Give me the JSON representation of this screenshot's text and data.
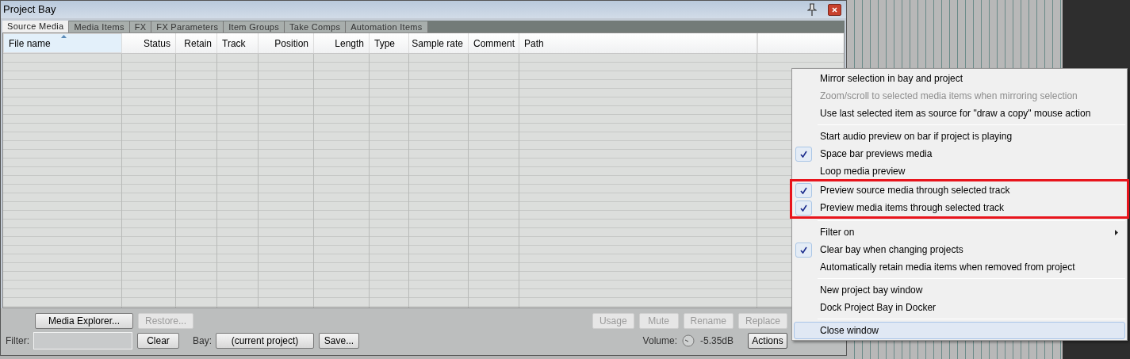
{
  "window": {
    "title": "Project Bay"
  },
  "tabs": [
    {
      "label": "Source Media",
      "selected": true
    },
    {
      "label": "Media Items",
      "selected": false
    },
    {
      "label": "FX",
      "selected": false
    },
    {
      "label": "FX Parameters",
      "selected": false
    },
    {
      "label": "Item Groups",
      "selected": false
    },
    {
      "label": "Take Comps",
      "selected": false
    },
    {
      "label": "Automation Items",
      "selected": false
    }
  ],
  "table": {
    "columns": [
      {
        "label": "File name",
        "sorted": true
      },
      {
        "label": "Status",
        "sorted": false
      },
      {
        "label": "Retain",
        "sorted": false
      },
      {
        "label": "Track",
        "sorted": false
      },
      {
        "label": "Position",
        "sorted": false
      },
      {
        "label": "Length",
        "sorted": false
      },
      {
        "label": "Type",
        "sorted": false
      },
      {
        "label": "Sample rate",
        "sorted": false
      },
      {
        "label": "Comment",
        "sorted": false
      },
      {
        "label": "Path",
        "sorted": false
      }
    ]
  },
  "bottom_bar": {
    "top_buttons": [
      {
        "label": "Media Explorer...",
        "disabled": false
      },
      {
        "label": "Restore...",
        "disabled": true
      }
    ],
    "right_buttons": [
      {
        "label": "Usage",
        "disabled": true
      },
      {
        "label": "Mute",
        "disabled": true
      },
      {
        "label": "Rename",
        "disabled": true
      },
      {
        "label": "Replace",
        "disabled": true
      }
    ],
    "filter_label": "Filter:",
    "clear_button": "Clear",
    "bay_label": "Bay:",
    "bay_button": "(current project)",
    "save_button": "Save...",
    "volume_label": "Volume:",
    "volume_reading": "-5.35dB",
    "actions_button": "Actions"
  },
  "menu": {
    "sections": [
      [
        {
          "label": "Mirror selection in bay and project",
          "checked": false,
          "disabled": false
        },
        {
          "label": "Zoom/scroll to selected media items when mirroring selection",
          "checked": false,
          "disabled": true
        },
        {
          "label": "Use last selected item as source for \"draw a copy\" mouse action",
          "checked": false,
          "disabled": false
        }
      ],
      [
        {
          "label": "Start audio preview on bar if project is playing",
          "checked": false,
          "disabled": false
        },
        {
          "label": "Space bar previews media",
          "checked": true,
          "disabled": false
        },
        {
          "label": "Loop media preview",
          "checked": false,
          "disabled": false
        },
        {
          "label": "Preview source media through selected track",
          "checked": true,
          "disabled": false,
          "annotated": true
        },
        {
          "label": "Preview media items through selected track",
          "checked": true,
          "disabled": false,
          "annotated": true
        }
      ],
      [
        {
          "label": "Filter on",
          "checked": false,
          "disabled": false,
          "submenu": true
        },
        {
          "label": "Clear bay when changing projects",
          "checked": true,
          "disabled": false
        },
        {
          "label": "Automatically retain media items when removed from project",
          "checked": false,
          "disabled": false
        }
      ],
      [
        {
          "label": "New project bay window",
          "checked": false,
          "disabled": false
        },
        {
          "label": "Dock Project Bay in Docker",
          "checked": false,
          "disabled": false
        }
      ],
      [
        {
          "label": "Close window",
          "checked": false,
          "disabled": false,
          "hovered": true
        }
      ]
    ]
  }
}
